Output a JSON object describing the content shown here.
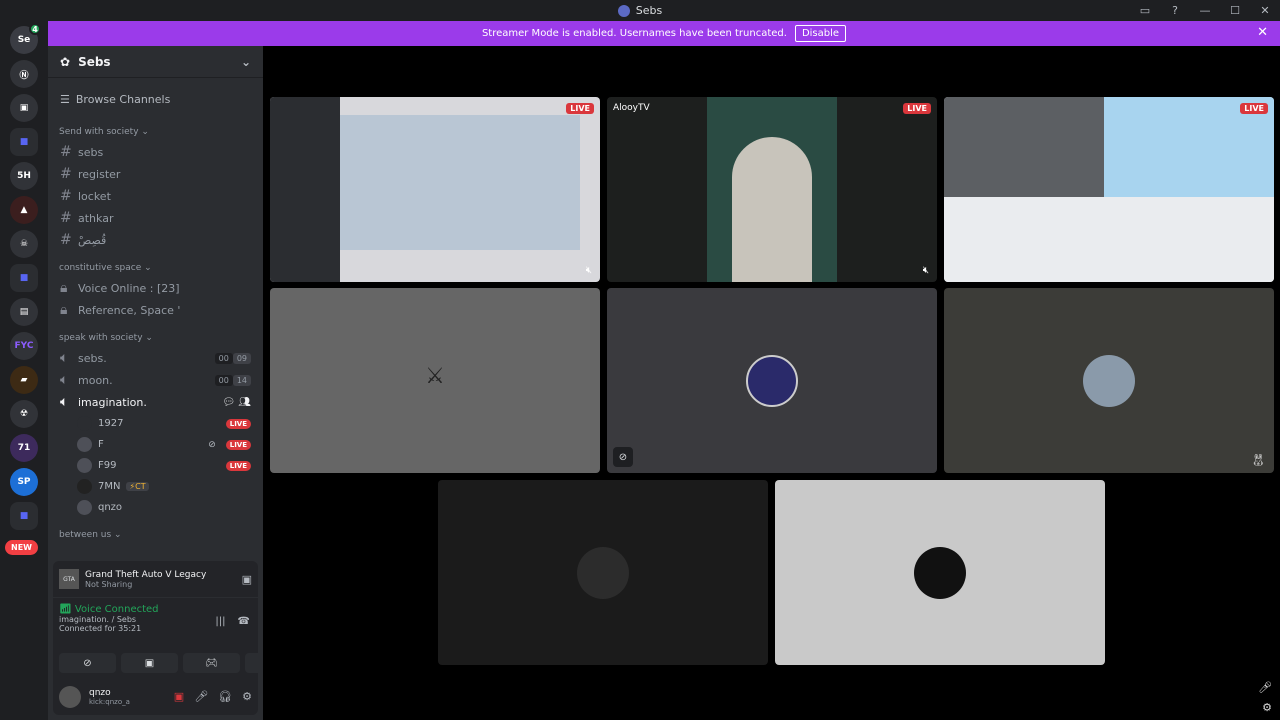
{
  "window": {
    "title": "Sebs"
  },
  "banner": {
    "text": "Streamer Mode is enabled. Usernames have been truncated.",
    "disable": "Disable"
  },
  "server": {
    "name": "Sebs"
  },
  "browse": "Browse Channels",
  "categories": [
    {
      "label": "Send with society ⌄",
      "channels": [
        "sebs",
        "register",
        "locket",
        "athkar",
        "قُصِصْ"
      ]
    },
    {
      "label": "constitutive space ⌄",
      "channels": [
        "Voice Online : [23]",
        "Reference, Space '"
      ]
    },
    {
      "label": "speak with society ⌄",
      "channels": [
        "sebs.",
        "moon.",
        "imagination."
      ]
    },
    {
      "label": "between us ⌄"
    }
  ],
  "voice_counts": {
    "sebs": [
      "00",
      "09"
    ],
    "moon": [
      "00",
      "14"
    ]
  },
  "voice_users": [
    {
      "name": "1927",
      "live": "LIVE"
    },
    {
      "name": "F",
      "live": "LIVE"
    },
    {
      "name": "F99",
      "live": "LIVE"
    },
    {
      "name": "7MN",
      "badge": "⚡CT"
    },
    {
      "name": "qnzo"
    }
  ],
  "new_badge": "NEW",
  "activity": {
    "name": "Grand Theft Auto V Legacy",
    "sub": "Not Sharing"
  },
  "voice": {
    "status": "Voice Connected",
    "channel": "imagination. / Sebs",
    "duration": "Connected for 35:21"
  },
  "user": {
    "name": "qnzo",
    "sub": "kick:qnzo_a"
  },
  "tiles": {
    "t1_live": "LIVE",
    "t2_name": "AlooyTV",
    "t2_live": "LIVE",
    "t3_live": "LIVE"
  },
  "colors": {
    "accent": "#9b3bea",
    "live": "#da373c",
    "connected": "#23a55a"
  }
}
